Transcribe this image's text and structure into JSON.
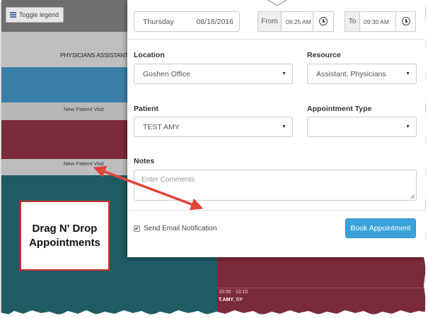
{
  "legend": {
    "label": "Toggle legend"
  },
  "calendar": {
    "resource_header": "PHYSICIANS ASSISTANT",
    "visit_1": "New Patient Visit",
    "visit_2": "New Patient Visit",
    "slot_time": "10:00 - 10:15",
    "slot_name_bold": "T.AMY",
    "slot_name_rest": ", EP"
  },
  "modal": {
    "day": "Thursday",
    "date": "08/18/2016",
    "from_label": "From",
    "from_time": "09:25 AM",
    "to_label": "To",
    "to_time": "09:30 AM",
    "location_label": "Location",
    "location_value": "Goshen Office",
    "resource_label": "Resource",
    "resource_value": "Assistant, Physicians",
    "patient_label": "Patient",
    "patient_value": "TEST AMY",
    "appt_type_label": "Appointment Type",
    "appt_type_value": "",
    "notes_label": "Notes",
    "notes_placeholder": "Enter Comments",
    "email_label": "Send Email Notification",
    "email_checked": true,
    "book_label": "Book Appointment"
  },
  "callout": {
    "text": "Drag N' Drop\nAppointments"
  },
  "colors": {
    "accent_button": "#3aa3d9",
    "callout_border": "#d2302e",
    "arrow": "#e0443a",
    "maroon": "#7b2a3b",
    "teal": "#1f5b62",
    "blue": "#3a7fa8"
  },
  "icons": [
    "list-icon",
    "clock-icon",
    "chevron-down-icon",
    "checkbox-icon"
  ]
}
